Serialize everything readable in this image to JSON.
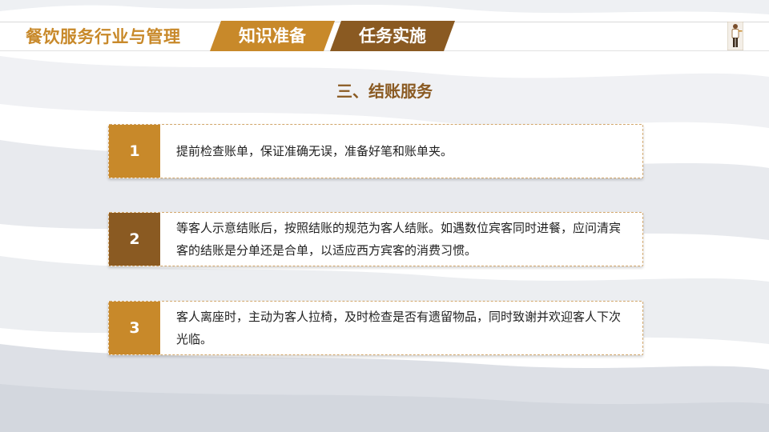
{
  "header": {
    "course_title": "餐饮服务行业与管理",
    "tabs": [
      {
        "label": "知识准备",
        "color": "#c8892a"
      },
      {
        "label": "任务实施",
        "color": "#8a5a22"
      }
    ]
  },
  "section_title": "三、结账服务",
  "steps": [
    {
      "number": "1",
      "text": "提前检查账单，保证准确无误，准备好笔和账单夹。"
    },
    {
      "number": "2",
      "text": "等客人示意结账后，按照结账的规范为客人结账。如遇数位宾客同时进餐，应问清宾客的结账是分单还是合单，以适应西方宾客的消费习惯。"
    },
    {
      "number": "3",
      "text": "客人离座时，主动为客人拉椅，及时检查是否有遗留物品，同时致谢并欢迎客人下次光临。"
    }
  ],
  "colors": {
    "accent_gold": "#c8892a",
    "accent_brown": "#8a5a22",
    "text": "#222222"
  },
  "icons": {
    "corner": "waiter-figure-icon"
  }
}
